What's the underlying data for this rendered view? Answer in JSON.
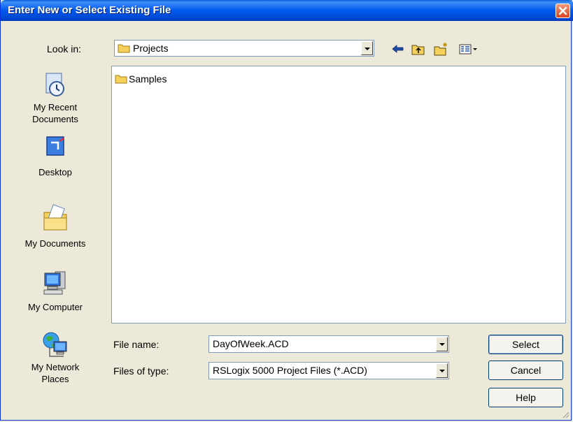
{
  "dialog": {
    "title": "Enter New or Select Existing File"
  },
  "toolbar": {
    "look_in_label": "Look in:",
    "look_in_value": "Projects",
    "icons": [
      "back-arrow-icon",
      "up-folder-icon",
      "new-folder-icon",
      "views-menu-icon"
    ]
  },
  "places": [
    {
      "label": "My Recent Documents",
      "line1": "My Recent",
      "line2": "Documents",
      "icon": "recent-documents-icon"
    },
    {
      "label": "Desktop",
      "line1": "Desktop",
      "line2": "",
      "icon": "desktop-icon"
    },
    {
      "label": "My Documents",
      "line1": "My Documents",
      "line2": "",
      "icon": "my-documents-icon"
    },
    {
      "label": "My Computer",
      "line1": "My Computer",
      "line2": "",
      "icon": "my-computer-icon"
    },
    {
      "label": "My Network Places",
      "line1": "My Network",
      "line2": "Places",
      "icon": "network-places-icon"
    }
  ],
  "files": [
    {
      "name": "Samples",
      "type": "folder"
    }
  ],
  "form": {
    "file_name_label": "File name:",
    "file_name_value": "DayOfWeek.ACD",
    "file_type_label": "Files of type:",
    "file_type_value": "RSLogix 5000 Project Files (*.ACD)"
  },
  "buttons": {
    "select": "Select",
    "cancel": "Cancel",
    "help": "Help"
  },
  "colors": {
    "titlebar": "#0058ee",
    "close": "#d8451d",
    "face": "#ece9d8",
    "folder": "#f5d05b"
  }
}
